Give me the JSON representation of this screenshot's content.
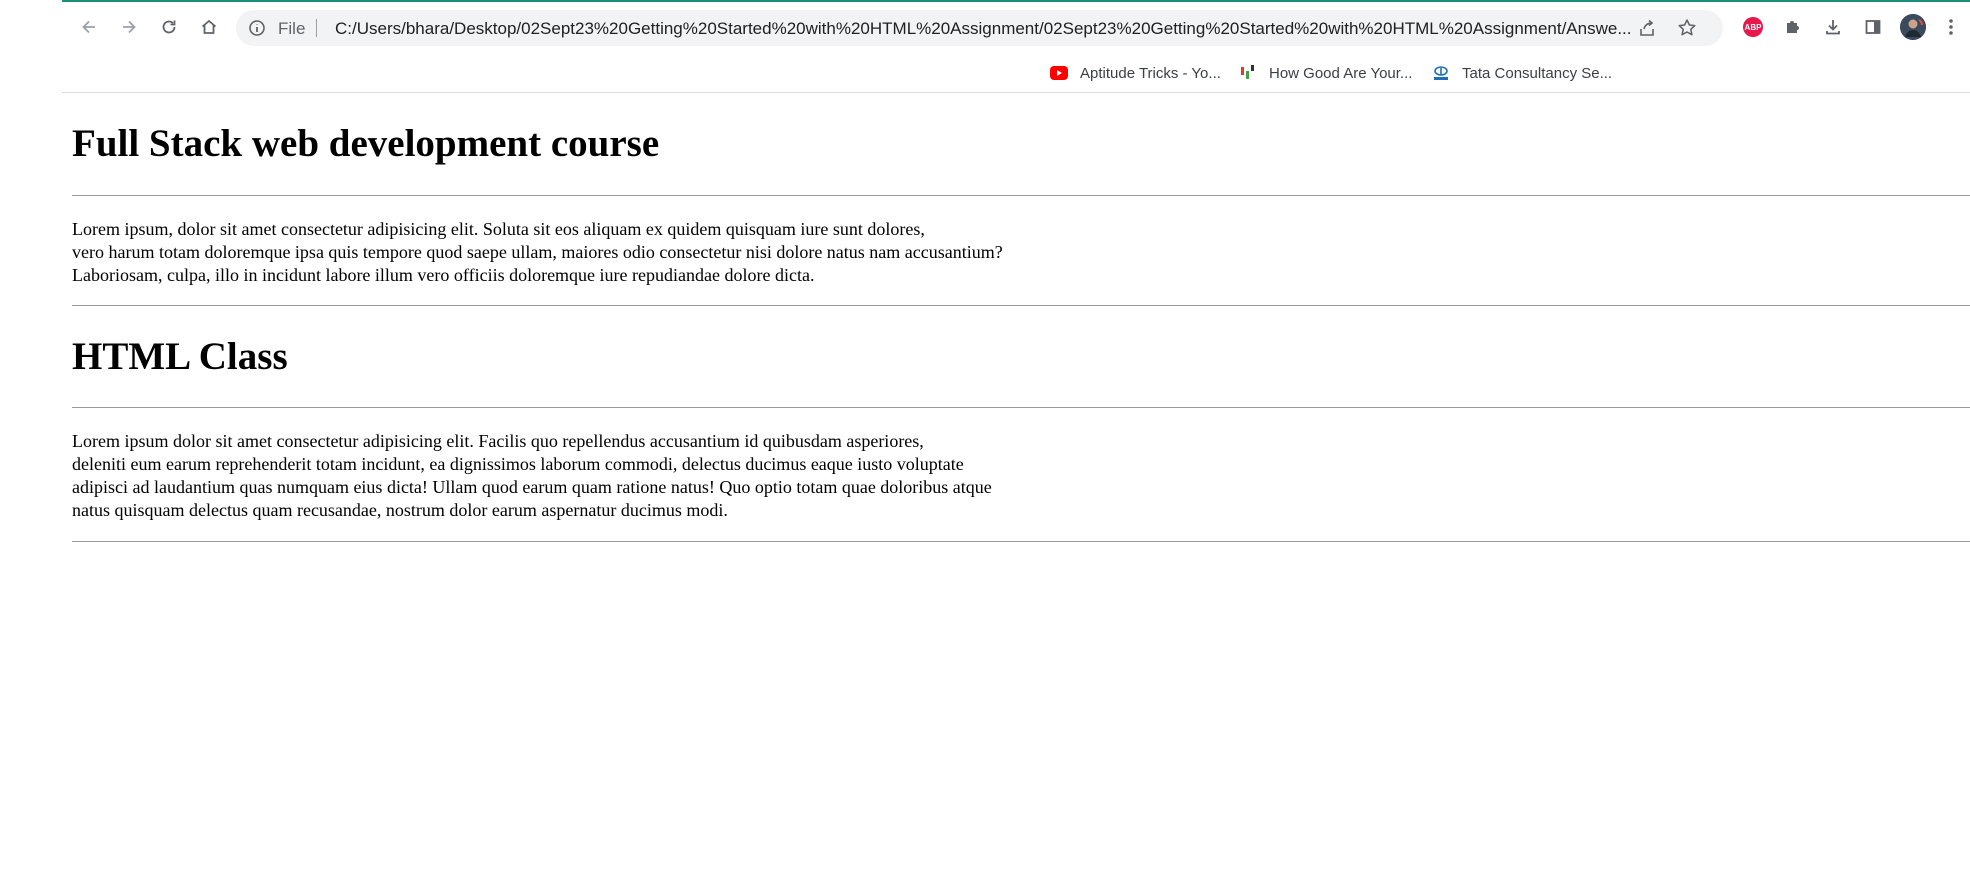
{
  "browser": {
    "omnibox": {
      "scheme_label": "File",
      "url": "C:/Users/bhara/Desktop/02Sept23%20Getting%20Started%20with%20HTML%20Assignment/02Sept23%20Getting%20Started%20with%20HTML%20Assignment/Answe..."
    },
    "extensions": {
      "adblock_label": "ABP"
    },
    "bookmarks": [
      {
        "label": "Aptitude Tricks - Yo...",
        "icon": "youtube-icon"
      },
      {
        "label": "How Good Are Your...",
        "icon": "bars-icon"
      },
      {
        "label": "Tata Consultancy Se...",
        "icon": "tata-icon"
      }
    ]
  },
  "page": {
    "heading1": "Full Stack web development course",
    "para1": [
      "Lorem ipsum, dolor sit amet consectetur adipisicing elit. Soluta sit eos aliquam ex quidem quisquam iure sunt dolores,",
      "vero harum totam doloremque ipsa quis tempore quod saepe ullam, maiores odio consectetur nisi dolore natus nam accusantium?",
      "Laboriosam, culpa, illo in incidunt labore illum vero officiis doloremque iure repudiandae dolore dicta."
    ],
    "heading2": "HTML Class",
    "para2": [
      "Lorem ipsum dolor sit amet consectetur adipisicing elit. Facilis quo repellendus accusantium id quibusdam asperiores,",
      "deleniti eum earum reprehenderit totam incidunt, ea dignissimos laborum commodi, delectus ducimus eaque iusto voluptate",
      "adipisci ad laudantium quas numquam eius dicta! Ullam quod earum quam ratione natus! Quo optio totam quae doloribus atque",
      "natus quisquam delectus quam recusandae, nostrum dolor earum aspernatur ducimus modi."
    ]
  },
  "colors": {
    "tab_accent": "#1a8f7a",
    "omnibox_bg": "#f1f3f4",
    "adblock_red": "#e8174c",
    "youtube_red": "#ff0000"
  }
}
